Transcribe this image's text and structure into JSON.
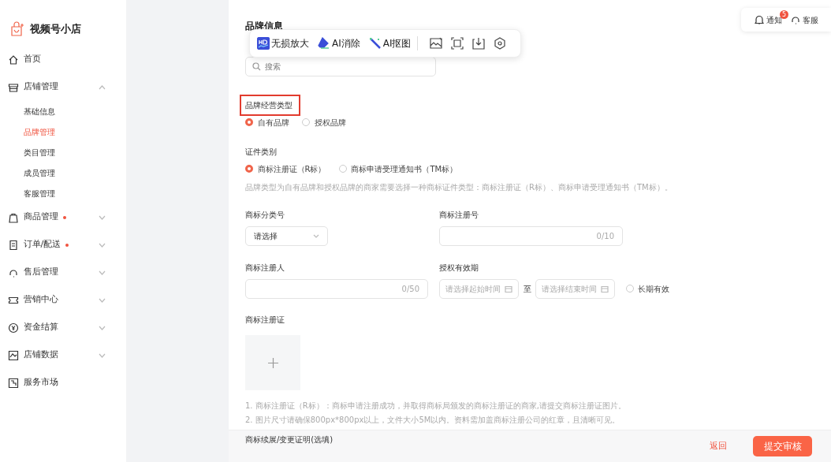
{
  "sidebar": {
    "logo_text": "视频号小店",
    "items": [
      {
        "kind": "link",
        "label": "首页"
      },
      {
        "kind": "group",
        "label": "店铺管理",
        "expanded": true,
        "dot": false,
        "children": [
          {
            "label": "基础信息",
            "selected": false
          },
          {
            "label": "品牌管理",
            "selected": true
          },
          {
            "label": "类目管理",
            "selected": false
          },
          {
            "label": "成员管理",
            "selected": false
          },
          {
            "label": "客服管理",
            "selected": false
          }
        ]
      },
      {
        "kind": "group",
        "label": "商品管理",
        "expanded": false,
        "dot": true
      },
      {
        "kind": "group",
        "label": "订单/配送",
        "expanded": false,
        "dot": true
      },
      {
        "kind": "group",
        "label": "售后管理",
        "expanded": false,
        "dot": false
      },
      {
        "kind": "group",
        "label": "营销中心",
        "expanded": false,
        "dot": false
      },
      {
        "kind": "group",
        "label": "资金结算",
        "expanded": false,
        "dot": false
      },
      {
        "kind": "group",
        "label": "店铺数据",
        "expanded": false,
        "dot": false
      },
      {
        "kind": "link",
        "label": "服务市场"
      }
    ]
  },
  "header_actions": [
    {
      "label": "通知",
      "badge": "5"
    },
    {
      "label": "客服"
    }
  ],
  "image_toolbar": {
    "buttons": [
      "无损放大",
      "AI消除",
      "AI抠图"
    ]
  },
  "form": {
    "title": "品牌信息",
    "search": {
      "placeholder": "搜索"
    },
    "rows": [
      [
        {
          "kind": "radio",
          "label": "品牌经营类型",
          "highlighted": true,
          "options": [
            {
              "label": "自有品牌",
              "selected": true
            },
            {
              "label": "授权品牌",
              "selected": false
            }
          ]
        }
      ],
      [
        {
          "kind": "radio",
          "label": "证件类别",
          "highlighted": false,
          "options": [
            {
              "label": "商标注册证（R标）",
              "selected": true
            },
            {
              "label": "商标申请受理通知书（TM标）",
              "selected": false
            }
          ],
          "hint": "品牌类型为自有品牌和授权品牌的商家需要选择一种商标证件类型：商标注册证（R标）、商标申请受理通知书（TM标）。"
        }
      ],
      [
        {
          "kind": "select",
          "label": "商标分类号",
          "value": "请选择"
        },
        {
          "kind": "text",
          "label": "商标注册号",
          "counter": "0/10"
        }
      ],
      [
        {
          "kind": "text",
          "label": "商标注册人",
          "counter": "0/50"
        },
        {
          "kind": "daterange",
          "label": "授权有效期",
          "start_placeholder": "请选择起始时间",
          "separator": "至",
          "end_placeholder": "请选择结束时间",
          "option": {
            "label": "长期有效",
            "selected": false
          }
        }
      ],
      [
        {
          "kind": "upload",
          "label": "商标注册证",
          "notes": [
            "1. 商标注册证（R标）：商标申请注册成功，并取得商标局颁发的商标注册证的商家,请提交商标注册证图片。",
            "2. 图片尺寸请确保800px*800px以上，文件大小5M以内。资料需加盖商标注册公司的红章，且清晰可见。"
          ]
        }
      ],
      [
        {
          "kind": "label",
          "label": "商标续展/变更证明(选填)"
        }
      ]
    ]
  },
  "footer": {
    "back": "返回",
    "submit": "提交审核"
  }
}
